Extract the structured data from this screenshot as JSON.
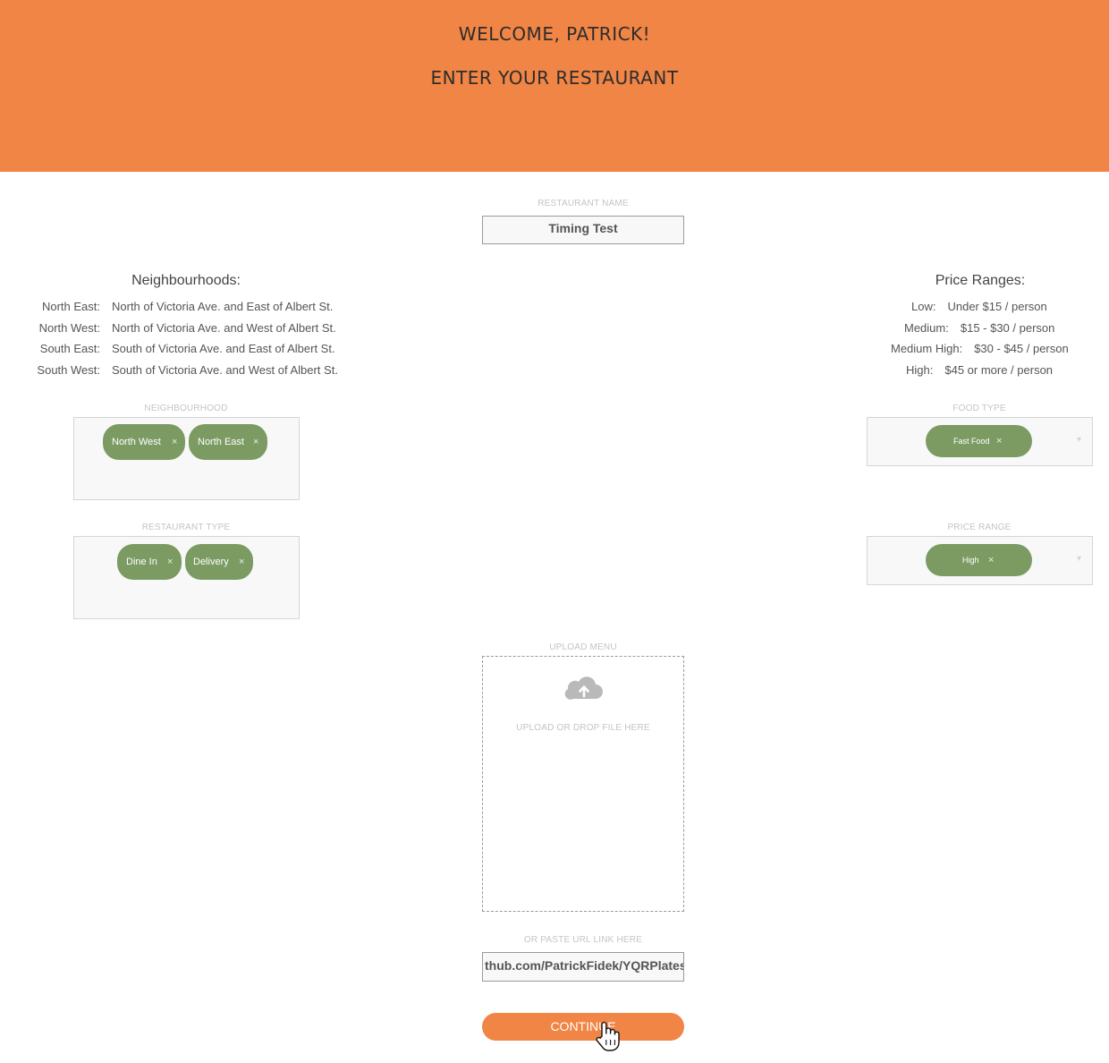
{
  "header": {
    "welcome": "WELCOME, PATRICK!",
    "subtitle": "ENTER YOUR RESTAURANT",
    "background": "#f08545"
  },
  "restaurant_name": {
    "label": "RESTAURANT NAME",
    "value": "Timing Test"
  },
  "neighbourhoods_info": {
    "title": "Neighbourhoods:",
    "rows": [
      {
        "key": "North East:",
        "value": "North of Victoria Ave. and East of Albert St."
      },
      {
        "key": "North West:",
        "value": "North of Victoria Ave. and West of Albert St."
      },
      {
        "key": "South East:",
        "value": "South of Victoria Ave. and East of Albert St."
      },
      {
        "key": "South West:",
        "value": "South of Victoria Ave. and West of Albert St."
      }
    ]
  },
  "price_ranges_info": {
    "title": "Price Ranges:",
    "rows": [
      {
        "key": "Low:",
        "value": "Under $15 / person"
      },
      {
        "key": "Medium:",
        "value": "$15 - $30 / person"
      },
      {
        "key": "Medium High:",
        "value": "$30 - $45 / person"
      },
      {
        "key": "High:",
        "value": "$45 or more / person"
      }
    ]
  },
  "neighbourhood_select": {
    "label": "NEIGHBOURHOOD",
    "chips": [
      "North West",
      "North East"
    ]
  },
  "food_type_select": {
    "label": "FOOD TYPE",
    "chips": [
      "Fast Food"
    ]
  },
  "restaurant_type_select": {
    "label": "RESTAURANT TYPE",
    "chips": [
      "Dine In",
      "Delivery"
    ]
  },
  "price_range_select": {
    "label": "PRICE RANGE",
    "chips": [
      "High"
    ]
  },
  "chip_remove_glyph": "×",
  "chip_color": "#7b9b63",
  "upload": {
    "label": "UPLOAD MENU",
    "hint": "UPLOAD OR DROP FILE HERE",
    "icon": "cloud-upload-icon"
  },
  "url": {
    "label": "OR PASTE URL LINK HERE",
    "value": "thub.com/PatrickFidek/YQRPlates"
  },
  "continue_button": {
    "label": "CONTINUE",
    "color": "#f08545"
  }
}
